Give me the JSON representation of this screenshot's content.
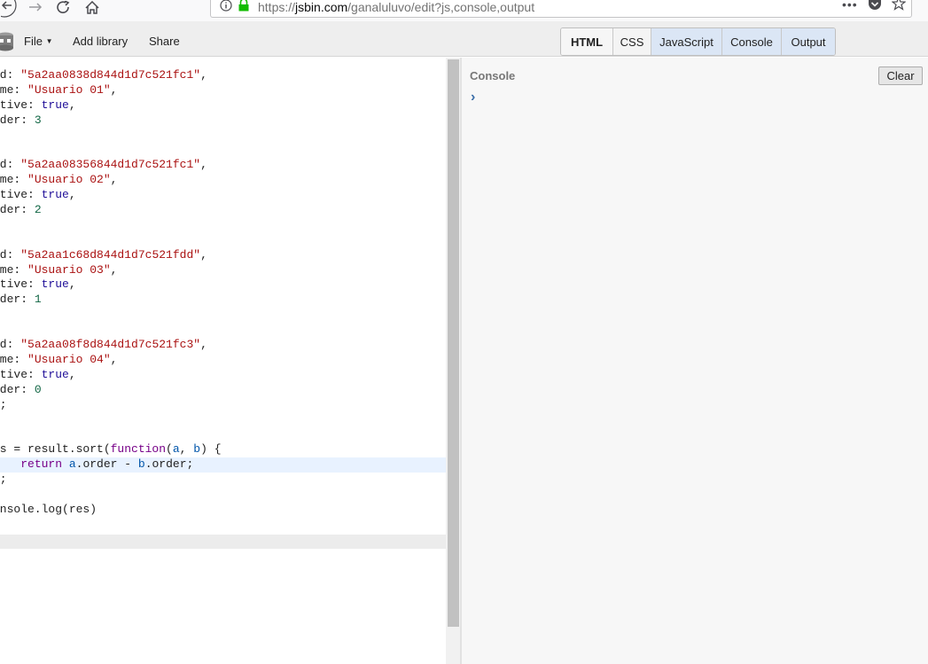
{
  "browser": {
    "url_prefix": "https://",
    "url_host": "jsbin.com",
    "url_path": "/ganaluluvo/edit?js,console,output",
    "back_icon": "back-arrow-icon",
    "forward_icon": "forward-arrow-icon",
    "reload_icon": "reload-icon",
    "home_icon": "home-icon"
  },
  "toolbar": {
    "file_label": "File",
    "add_library_label": "Add library",
    "share_label": "Share"
  },
  "tabs": [
    {
      "label": "HTML"
    },
    {
      "label": "CSS"
    },
    {
      "label": "JavaScript"
    },
    {
      "label": "Console"
    },
    {
      "label": "Output"
    }
  ],
  "editor": {
    "lines": [
      [
        [
          "",
          "id: "
        ],
        [
          "s",
          "\"5a2aa0838d844d1d7c521fc1\""
        ],
        [
          "",
          ","
        ]
      ],
      [
        [
          "",
          "ame: "
        ],
        [
          "s",
          "\"Usuario 01\""
        ],
        [
          "",
          ","
        ]
      ],
      [
        [
          "",
          "ctive: "
        ],
        [
          "a",
          "true"
        ],
        [
          "",
          ","
        ]
      ],
      [
        [
          "",
          "rder: "
        ],
        [
          "n",
          "3"
        ]
      ],
      [
        [
          "",
          ","
        ]
      ],
      [
        [
          "",
          ""
        ]
      ],
      [
        [
          "",
          "id: "
        ],
        [
          "s",
          "\"5a2aa08356844d1d7c521fc1\""
        ],
        [
          "",
          ","
        ]
      ],
      [
        [
          "",
          "ame: "
        ],
        [
          "s",
          "\"Usuario 02\""
        ],
        [
          "",
          ","
        ]
      ],
      [
        [
          "",
          "ctive: "
        ],
        [
          "a",
          "true"
        ],
        [
          "",
          ","
        ]
      ],
      [
        [
          "",
          "rder: "
        ],
        [
          "n",
          "2"
        ]
      ],
      [
        [
          "",
          ","
        ]
      ],
      [
        [
          "",
          ""
        ]
      ],
      [
        [
          "",
          "id: "
        ],
        [
          "s",
          "\"5a2aa1c68d844d1d7c521fdd\""
        ],
        [
          "",
          ","
        ]
      ],
      [
        [
          "",
          "ame: "
        ],
        [
          "s",
          "\"Usuario 03\""
        ],
        [
          "",
          ","
        ]
      ],
      [
        [
          "",
          "ctive: "
        ],
        [
          "a",
          "true"
        ],
        [
          "",
          ","
        ]
      ],
      [
        [
          "",
          "rder: "
        ],
        [
          "n",
          "1"
        ]
      ],
      [
        [
          "",
          ","
        ]
      ],
      [
        [
          "",
          ""
        ]
      ],
      [
        [
          "",
          "id: "
        ],
        [
          "s",
          "\"5a2aa08f8d844d1d7c521fc3\""
        ],
        [
          "",
          ","
        ]
      ],
      [
        [
          "",
          "ame: "
        ],
        [
          "s",
          "\"Usuario 04\""
        ],
        [
          "",
          ","
        ]
      ],
      [
        [
          "",
          "ctive: "
        ],
        [
          "a",
          "true"
        ],
        [
          "",
          ","
        ]
      ],
      [
        [
          "",
          "rder: "
        ],
        [
          "n",
          "0"
        ]
      ],
      [
        [
          "",
          "];"
        ]
      ],
      [
        [
          "",
          ""
        ]
      ],
      [
        [
          "",
          ""
        ]
      ],
      [
        [
          "",
          "es = result.sort("
        ],
        [
          "k",
          "function"
        ],
        [
          "",
          "("
        ],
        [
          "v",
          "a"
        ],
        [
          "",
          ", "
        ],
        [
          "v",
          "b"
        ],
        [
          "",
          ") {"
        ]
      ],
      [
        [
          "",
          "    "
        ],
        [
          "k",
          "return"
        ],
        [
          "",
          " "
        ],
        [
          "v",
          "a"
        ],
        [
          "",
          ".order - "
        ],
        [
          "v",
          "b"
        ],
        [
          "",
          ".order;"
        ]
      ],
      [
        [
          "",
          ");"
        ]
      ],
      [
        [
          "",
          ""
        ]
      ],
      [
        [
          "",
          "onsole.log(res)"
        ]
      ]
    ],
    "highlight_line": 26
  },
  "console": {
    "title": "Console",
    "clear_label": "Clear",
    "prompt_glyph": "›"
  }
}
